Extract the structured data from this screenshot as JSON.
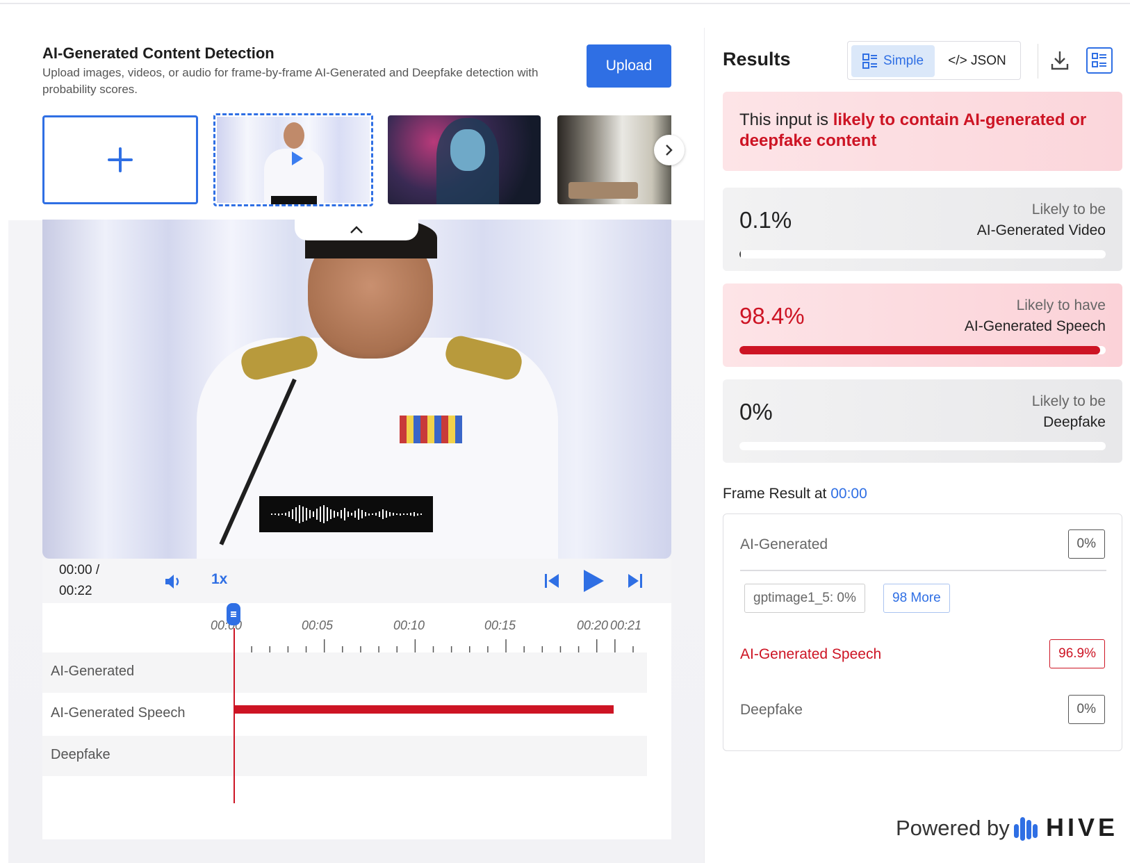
{
  "header": {
    "title": "AI-Generated Content Detection",
    "subtitle": "Upload images, videos, or audio for frame-by-frame AI-Generated and Deepfake detection with probability scores.",
    "upload_label": "Upload"
  },
  "thumbnails": [
    {
      "name": "add-media",
      "icon": "plus-icon"
    },
    {
      "name": "video-speech",
      "selected": true
    },
    {
      "name": "cyberpunk-woman"
    },
    {
      "name": "living-room"
    }
  ],
  "player": {
    "time_current": "00:00 /",
    "time_total": "00:22",
    "speed": "1x",
    "icons": [
      "volume-icon",
      "previous-frame-icon",
      "play-icon",
      "next-frame-icon"
    ]
  },
  "timeline": {
    "ticks": [
      "00:00",
      "00:05",
      "00:10",
      "00:15",
      "00:20",
      "00:21"
    ],
    "rows": [
      "AI-Generated",
      "AI-Generated Speech",
      "Deepfake"
    ]
  },
  "results": {
    "title": "Results",
    "view_simple": "Simple",
    "view_json": "</> JSON",
    "verdict_prefix": "This input is ",
    "verdict_highlight": "likely to contain AI-generated or deepfake content",
    "cards": [
      {
        "pct": "0.1%",
        "line1": "Likely to be",
        "line2": "AI-Generated Video",
        "fill": 0.001,
        "alert": false
      },
      {
        "pct": "98.4%",
        "line1": "Likely to have",
        "line2": "AI-Generated Speech",
        "fill": 0.984,
        "alert": true
      },
      {
        "pct": "0%",
        "line1": "Likely to be",
        "line2": "Deepfake",
        "fill": 0,
        "alert": false
      }
    ]
  },
  "frame_result": {
    "label": "Frame Result at ",
    "time": "00:00",
    "ai_generated_label": "AI-Generated",
    "ai_generated_value": "0%",
    "chip_model": "gptimage1_5: 0%",
    "chip_more": "98 More",
    "speech_label": "AI-Generated Speech",
    "speech_value": "96.9%",
    "deepfake_label": "Deepfake",
    "deepfake_value": "0%"
  },
  "footer": {
    "powered_by": "Powered by",
    "brand": "HIVE"
  },
  "colors": {
    "accent": "#2f6fe4",
    "alert": "#cd1424"
  }
}
